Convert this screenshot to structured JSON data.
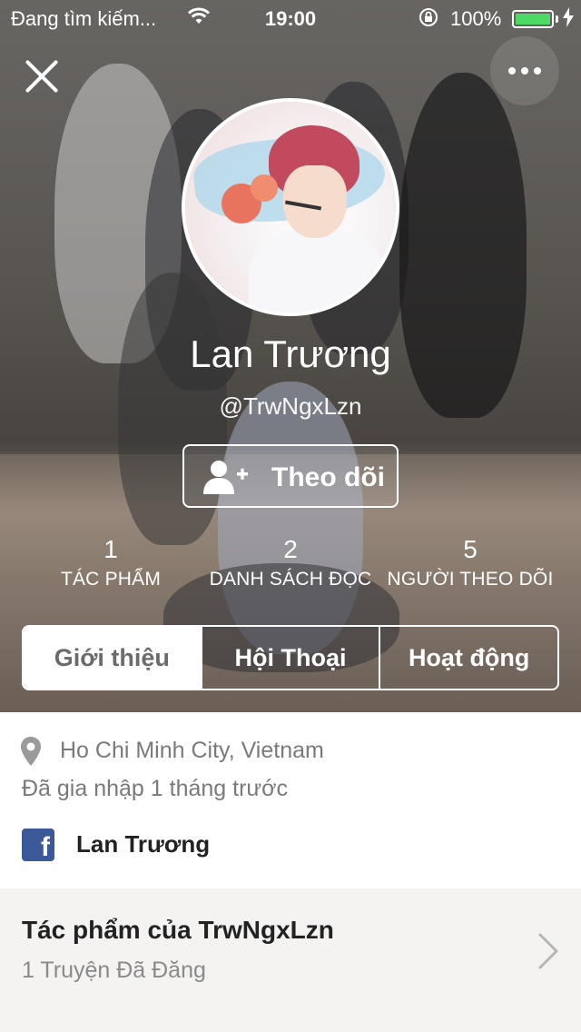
{
  "status_bar": {
    "carrier": "Đang tìm kiếm...",
    "time": "19:00",
    "battery_percent": "100%",
    "battery_level": 1.0,
    "battery_color": "#4cd964"
  },
  "header": {
    "close_icon": "close-icon",
    "more_icon": "more-dots-icon"
  },
  "profile": {
    "name": "Lan Trương",
    "handle": "@TrwNgxLzn",
    "follow_label": "Theo dõi",
    "follow_icon": "add-user-icon"
  },
  "stats": [
    {
      "value": "1",
      "label": "TÁC PHẨM"
    },
    {
      "value": "2",
      "label": "DANH SÁCH ĐỌC"
    },
    {
      "value": "5",
      "label": "NGƯỜI THEO DÕI"
    }
  ],
  "tabs": [
    {
      "label": "Giới thiệu",
      "active": true
    },
    {
      "label": "Hội Thoại",
      "active": false
    },
    {
      "label": "Hoạt động",
      "active": false
    }
  ],
  "about": {
    "location_icon": "location-pin-icon",
    "location": "Ho Chi Minh City, Vietnam",
    "joined": "Đã gia nhập 1 tháng trước",
    "facebook_icon": "facebook-icon",
    "facebook_name": "Lan Trương"
  },
  "works": {
    "title": "Tác phẩm của TrwNgxLzn",
    "subtitle": "1 Truyện Đã Đăng",
    "chevron_icon": "chevron-right-icon"
  },
  "colors": {
    "facebook": "#3b5998",
    "accent_white": "#ffffff"
  }
}
